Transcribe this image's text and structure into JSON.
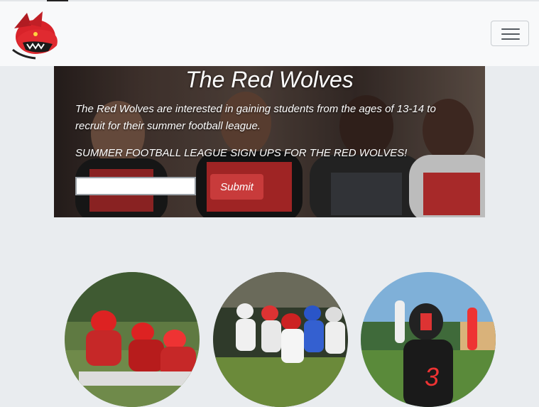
{
  "navbar": {
    "logo_icon": "red-wolf-logo-icon",
    "toggler_icon": "hamburger-menu-icon"
  },
  "hero": {
    "title": "The Red Wolves",
    "description": "The Red Wolves are interested in gaining students from the ages of 13-14 to recruit for their summer football league.",
    "signup_text": "SUMMER FOOTBALL LEAGUE SIGN UPS FOR THE RED WOLVES!",
    "email_value": "",
    "submit_label": "Submit"
  },
  "gallery": {
    "items": [
      {
        "image": "football-lineup-photo"
      },
      {
        "image": "football-kickoff-run-photo"
      },
      {
        "image": "football-player-celebration-photo"
      }
    ]
  },
  "colors": {
    "accent": "#c83b3b",
    "page_bg": "#e9ecef",
    "navbar_bg": "#f8f9fa"
  }
}
